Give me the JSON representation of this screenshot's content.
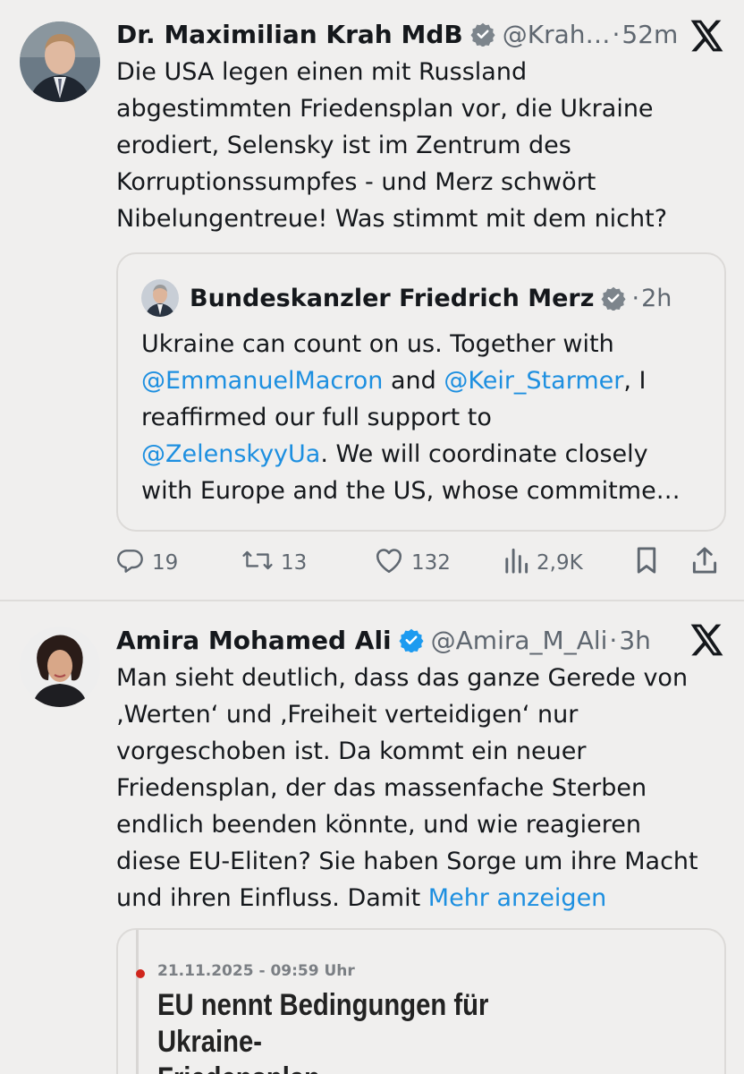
{
  "posts": [
    {
      "author_name": "Dr. Maximilian Krah MdB",
      "handle": "@Krah…",
      "separator": "·",
      "time": "52m",
      "text": "Die USA legen einen mit Russland\nabgestimmten Friedensplan vor, die Ukraine\nerodiert, Selensky ist im Zentrum des\nKorruptionssumpfes - und Merz schwört\nNibelungentreue! Was stimmt mit dem nicht?",
      "quote": {
        "author_name": "Bundeskanzler Friedrich Merz",
        "separator": "·",
        "time": "2h",
        "text_parts": [
          "Ukraine can count on us. Together with\n",
          "@EmmanuelMacron",
          " and ",
          "@Keir_Starmer",
          ", I\nreaffirmed our full support to\n",
          "@ZelenskyyUa",
          ". We will coordinate closely\nwith Europe and the US, whose commitme…"
        ]
      },
      "actions": {
        "replies": "19",
        "reposts": "13",
        "likes": "132",
        "views": "2,9K"
      }
    },
    {
      "author_name": "Amira Mohamed Ali",
      "handle": "@Amira_M_Ali",
      "separator": "·",
      "time": "3h",
      "text": "Man sieht deutlich, dass das ganze Gerede von\n‚Werten‘ und ‚Freiheit verteidigen‘ nur\nvorgeschoben ist. Da kommt ein neuer\nFriedensplan, der das massenfache Sterben\nendlich beenden könnte, und wie reagieren\ndiese EU-Eliten? Sie haben Sorge um ihre Macht\nund ihren Einfluss. Damit ",
      "show_more": "Mehr anzeigen",
      "news_card": {
        "date": "21.11.2025 - 09:59 Uhr",
        "headline": "EU nennt Bedingungen für Ukraine-\nFriedensplan"
      }
    }
  ],
  "colors": {
    "background": "#f0efee",
    "link": "#1d8fe0",
    "verified": "#1d9bf0",
    "muted": "#5f6770"
  },
  "icons": [
    "verified-badge-icon",
    "x-logo-icon",
    "reply-icon",
    "repost-icon",
    "like-icon",
    "views-icon",
    "bookmark-icon",
    "share-icon"
  ]
}
